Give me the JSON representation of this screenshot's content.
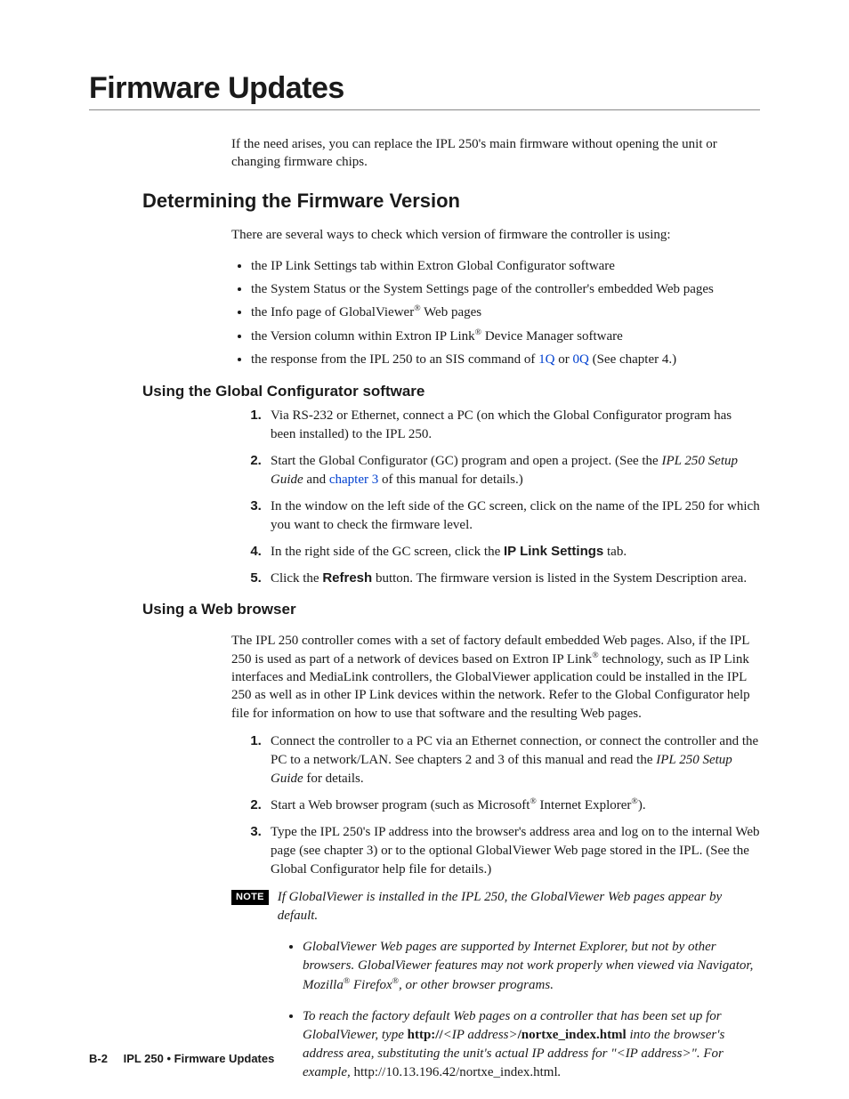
{
  "title": "Firmware Updates",
  "intro": "If the need arises, you can replace the IPL 250's main firmware without opening the unit or changing firmware chips.",
  "h2": "Determining the Firmware Version",
  "after_h2": "There are several ways to check which version of firmware the controller is using:",
  "bullets": {
    "b1": "the IP Link Settings tab within Extron Global Configurator software",
    "b2": "the System Status or the System Settings page of the controller's embedded Web pages",
    "b3_a": "the Info page of GlobalViewer",
    "b3_b": " Web pages",
    "b4_a": "the Version column within Extron IP Link",
    "b4_b": " Device Manager software",
    "b5_a": "the response from the IPL 250 to an SIS command of ",
    "b5_link1": "1Q",
    "b5_mid": " or ",
    "b5_link2": "0Q",
    "b5_b": "  (See chapter 4.)"
  },
  "h3a": "Using the Global Configurator software",
  "gc": {
    "s1": "Via RS-232 or Ethernet, connect a PC (on which the Global Configurator program has been installed) to the IPL 250.",
    "s2_a": "Start the Global Configurator (GC) program and open a project.  (See the ",
    "s2_i": "IPL 250 Setup Guide",
    "s2_b": " and ",
    "s2_link": "chapter 3",
    "s2_c": " of this manual for details.)",
    "s3": "In the window on the left side of the GC screen, click on the name of the IPL 250 for which you want to check the firmware level.",
    "s4_a": "In the right side of the GC screen, click the ",
    "s4_bold": "IP Link Settings",
    "s4_b": " tab.",
    "s5_a": "Click the ",
    "s5_bold": "Refresh",
    "s5_b": " button.  The firmware version is listed in the System Description area."
  },
  "h3b": "Using a Web browser",
  "wb_para_a": "The IPL 250 controller comes with a set of factory default embedded Web pages.  Also, if the IPL 250 is used as part of a network of devices based on Extron IP Link",
  "wb_para_b": " technology, such as IP Link interfaces and MediaLink controllers, the GlobalViewer application could be installed in the IPL 250 as well as in other IP Link devices within the network.  Refer to the Global Configurator help file for information on how to use that software and the resulting Web pages.",
  "wb": {
    "s1_a": "Connect the controller to a PC via an Ethernet connection, or connect the controller and the PC to a network/LAN.  See chapters 2 and 3 of this manual and read the ",
    "s1_i": "IPL 250 Setup Guide",
    "s1_b": " for details.",
    "s2_a": "Start a Web browser program (such as Microsoft",
    "s2_b": " Internet Explorer",
    "s2_c": ").",
    "s3": "Type the IPL 250's IP address into the browser's address area and log on to the internal Web page (see chapter 3) or to the optional GlobalViewer Web page stored in the IPL.  (See the Global Configurator help file for details.)"
  },
  "note_label": "NOTE",
  "note_text": "If GlobalViewer is installed in the IPL 250, the GlobalViewer Web pages appear by default.",
  "subnotes": {
    "n1_a": "GlobalViewer Web pages are supported by Internet Explorer, but not by other browsers.  GlobalViewer features may not work properly when viewed via Navigator, Mozilla",
    "n1_b": " Firefox",
    "n1_c": ", or other browser programs.",
    "n2_a": "To reach the factory default Web pages on a controller that has been set up for GlobalViewer, type ",
    "n2_bold1": "http://",
    "n2_mid1": "<IP address>",
    "n2_bold2": "/nortxe_index.html",
    "n2_b": " into the browser's address area, substituting the unit's actual IP address for \"<IP address>\".  For example, ",
    "n2_roman": "http://10.13.196.42/nortxe_index.html",
    "n2_end": "."
  },
  "footer": {
    "page": "B-2",
    "text": "IPL 250 • Firmware Updates"
  },
  "reg": "®"
}
